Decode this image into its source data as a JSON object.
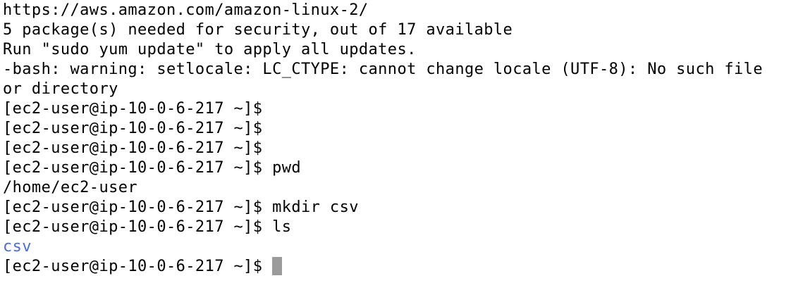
{
  "terminal": {
    "lines": [
      "https://aws.amazon.com/amazon-linux-2/",
      "5 package(s) needed for security, out of 17 available",
      "Run \"sudo yum update\" to apply all updates.",
      "-bash: warning: setlocale: LC_CTYPE: cannot change locale (UTF-8): No such file",
      "or directory",
      "[ec2-user@ip-10-0-6-217 ~]$",
      "[ec2-user@ip-10-0-6-217 ~]$",
      "[ec2-user@ip-10-0-6-217 ~]$",
      "[ec2-user@ip-10-0-6-217 ~]$ pwd",
      "/home/ec2-user",
      "[ec2-user@ip-10-0-6-217 ~]$ mkdir csv",
      "[ec2-user@ip-10-0-6-217 ~]$ ls",
      "csv",
      "[ec2-user@ip-10-0-6-217 ~]$ "
    ],
    "colors": {
      "background": "#ffffff",
      "text": "#000000",
      "directory": "#4a6fd6",
      "cursor": "#9b9b9b"
    }
  }
}
